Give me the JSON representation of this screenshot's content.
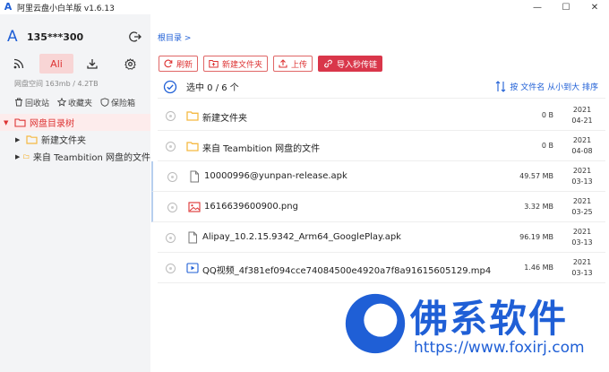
{
  "window": {
    "logo_letter": "A",
    "title": "阿里云盘小白羊版 v1.6.13",
    "minimize_glyph": "—",
    "maximize_glyph": "☐",
    "close_glyph": "✕"
  },
  "sidebar": {
    "avatar_letter": "A",
    "account_name": "135***300",
    "tools": [
      {
        "icon": "rss-icon"
      },
      {
        "label": "Ali",
        "icon": "ali-tab"
      },
      {
        "icon": "download-icon"
      },
      {
        "icon": "gear-icon"
      }
    ],
    "space": "网盘空间 163mb / 4.2TB",
    "links": [
      {
        "label": "回收站",
        "icon": "trash-icon"
      },
      {
        "label": "收藏夹",
        "icon": "star-icon"
      },
      {
        "label": "保险箱",
        "icon": "safe-icon"
      }
    ],
    "tree": {
      "root": "网盘目录树",
      "children": [
        "新建文件夹",
        "来自 Teambition 网盘的文件"
      ]
    }
  },
  "main": {
    "breadcrumb": "根目录 >",
    "actions": {
      "refresh": "刷新",
      "new_folder": "新建文件夹",
      "upload": "上传",
      "import_link": "导入秒传链"
    },
    "selection": "选中 0 / 6 个",
    "sort": "按 文件名 从小到大 排序",
    "files": [
      {
        "name": "新建文件夹",
        "type": "folder",
        "size": "0 B",
        "year": "2021",
        "date": "04-21"
      },
      {
        "name": "来自 Teambition 网盘的文件",
        "type": "folder",
        "size": "0 B",
        "year": "2021",
        "date": "04-08"
      },
      {
        "name": "10000996@yunpan-release.apk",
        "type": "file",
        "size": "49.57 MB",
        "year": "2021",
        "date": "03-13"
      },
      {
        "name": "1616639600900.png",
        "type": "image",
        "size": "3.32 MB",
        "year": "2021",
        "date": "03-25"
      },
      {
        "name": "Alipay_10.2.15.9342_Arm64_GooglePlay.apk",
        "type": "file",
        "size": "96.19 MB",
        "year": "2021",
        "date": "03-13"
      },
      {
        "name": "QQ视频_4f381ef094cce74084500e4920a7f8a91615605129.mp4",
        "type": "video",
        "size": "1.46 MB",
        "year": "2021",
        "date": "03-13"
      }
    ]
  },
  "watermark": {
    "title": "佛系软件",
    "url": "https://www.foxirj.com"
  },
  "colors": {
    "accent_red": "#d33333",
    "brand_blue": "#1f5fd6",
    "folder_yellow": "#f5b942"
  }
}
